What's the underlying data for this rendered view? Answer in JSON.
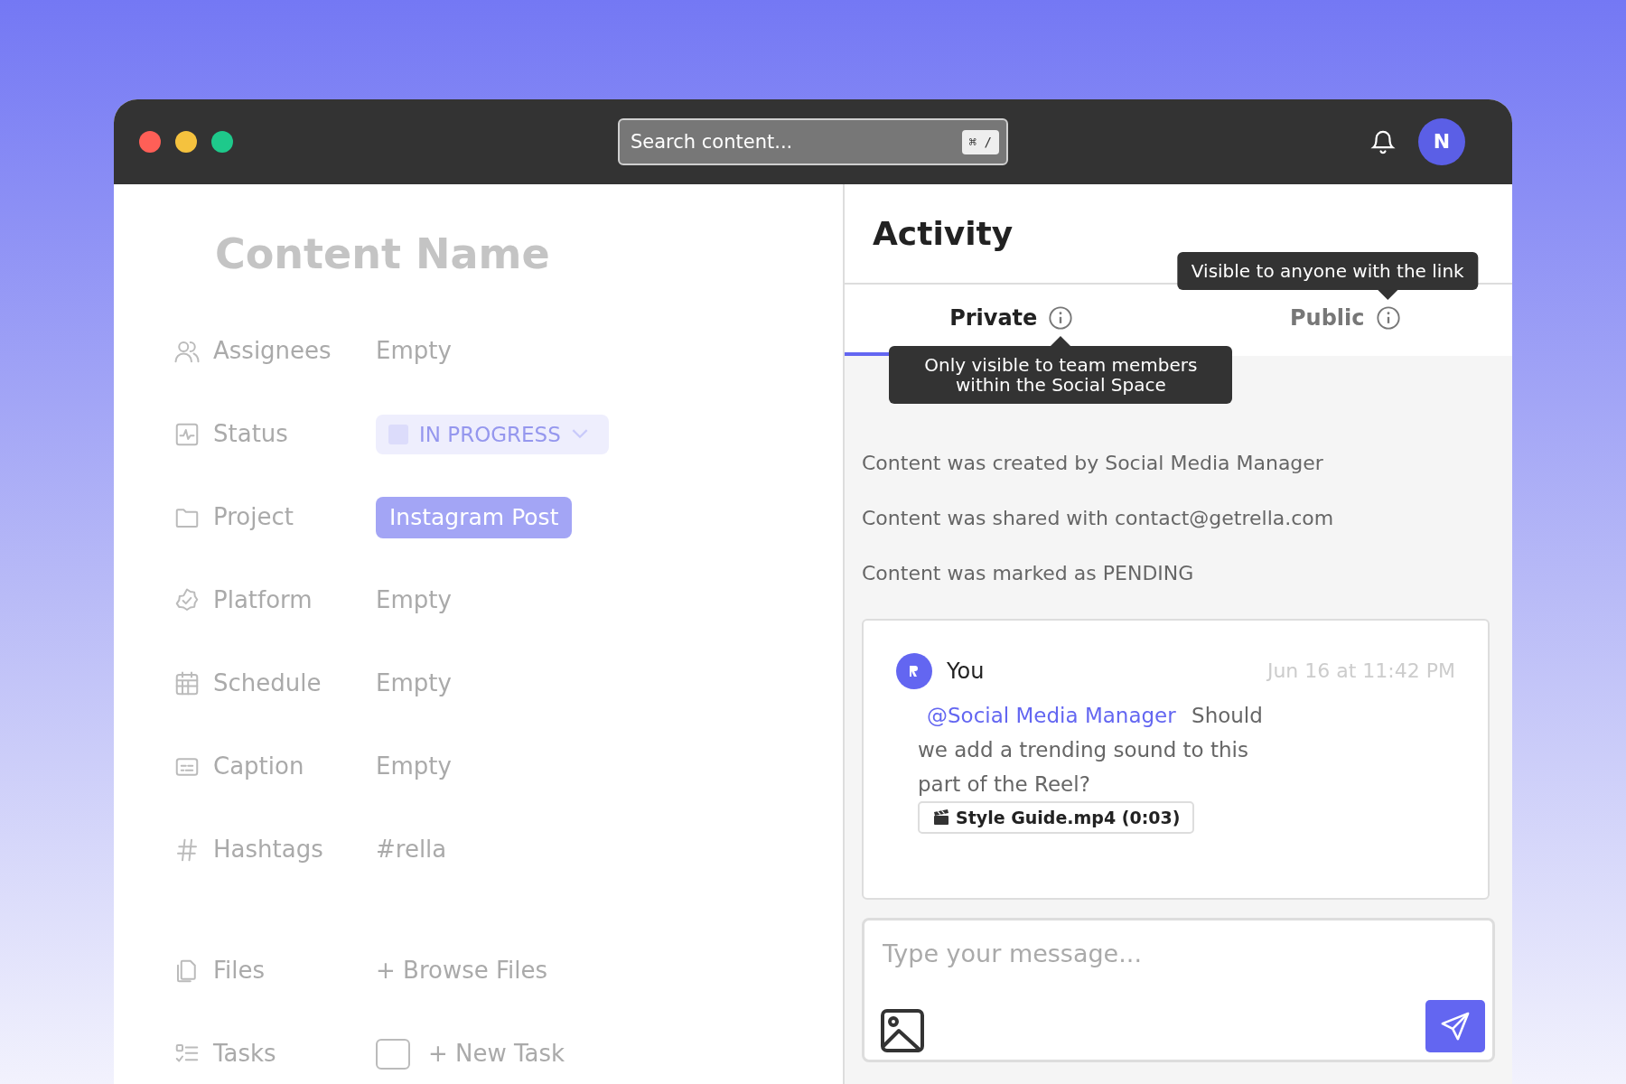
{
  "window": {
    "controls": [
      {
        "color": "#ff5f57"
      },
      {
        "color": "#f5c23e"
      },
      {
        "color": "#1ec98b"
      }
    ]
  },
  "search": {
    "placeholder": "Search content...",
    "shortcut": "⌘ /"
  },
  "user_avatar": {
    "initial": "N"
  },
  "content": {
    "dimmed": true,
    "title": "Content Name",
    "fields": [
      {
        "kind": "text",
        "label": "Assignees",
        "value": "Empty"
      },
      {
        "kind": "status",
        "label": "Status",
        "value": "IN PROGRESS"
      },
      {
        "kind": "tag",
        "label": "Project",
        "value": "Instagram Post"
      },
      {
        "kind": "text",
        "label": "Platform",
        "value": "Empty"
      },
      {
        "kind": "text",
        "label": "Schedule",
        "value": "Empty"
      },
      {
        "kind": "text",
        "label": "Caption",
        "value": "Empty"
      },
      {
        "kind": "text",
        "label": "Hashtags",
        "value": "#rella"
      },
      {
        "kind": "action",
        "label": "Files",
        "value": "+ Browse Files"
      },
      {
        "kind": "task",
        "label": "Tasks",
        "value": "+ New Task",
        "checked": false
      }
    ]
  },
  "activity": {
    "title": "Activity",
    "tabs": [
      {
        "label": "Private",
        "selected": true,
        "tooltip": "Only visible to team members within the Social Space"
      },
      {
        "label": "Public",
        "selected": false,
        "tooltip": "Visible to anyone with the link"
      }
    ],
    "events": [
      "Content was created by Social Media Manager",
      "Content was shared with contact@getrella.com",
      "Content was marked as PENDING"
    ],
    "comment": {
      "author": "You",
      "time": "Jun 16 at 11:42 PM",
      "mention": "@Social Media Manager",
      "text": "Should we add a trending sound to this part of the Reel?",
      "attachment": "Style Guide.mp4 (0:03)"
    },
    "composer": {
      "placeholder": "Type your message..."
    }
  }
}
